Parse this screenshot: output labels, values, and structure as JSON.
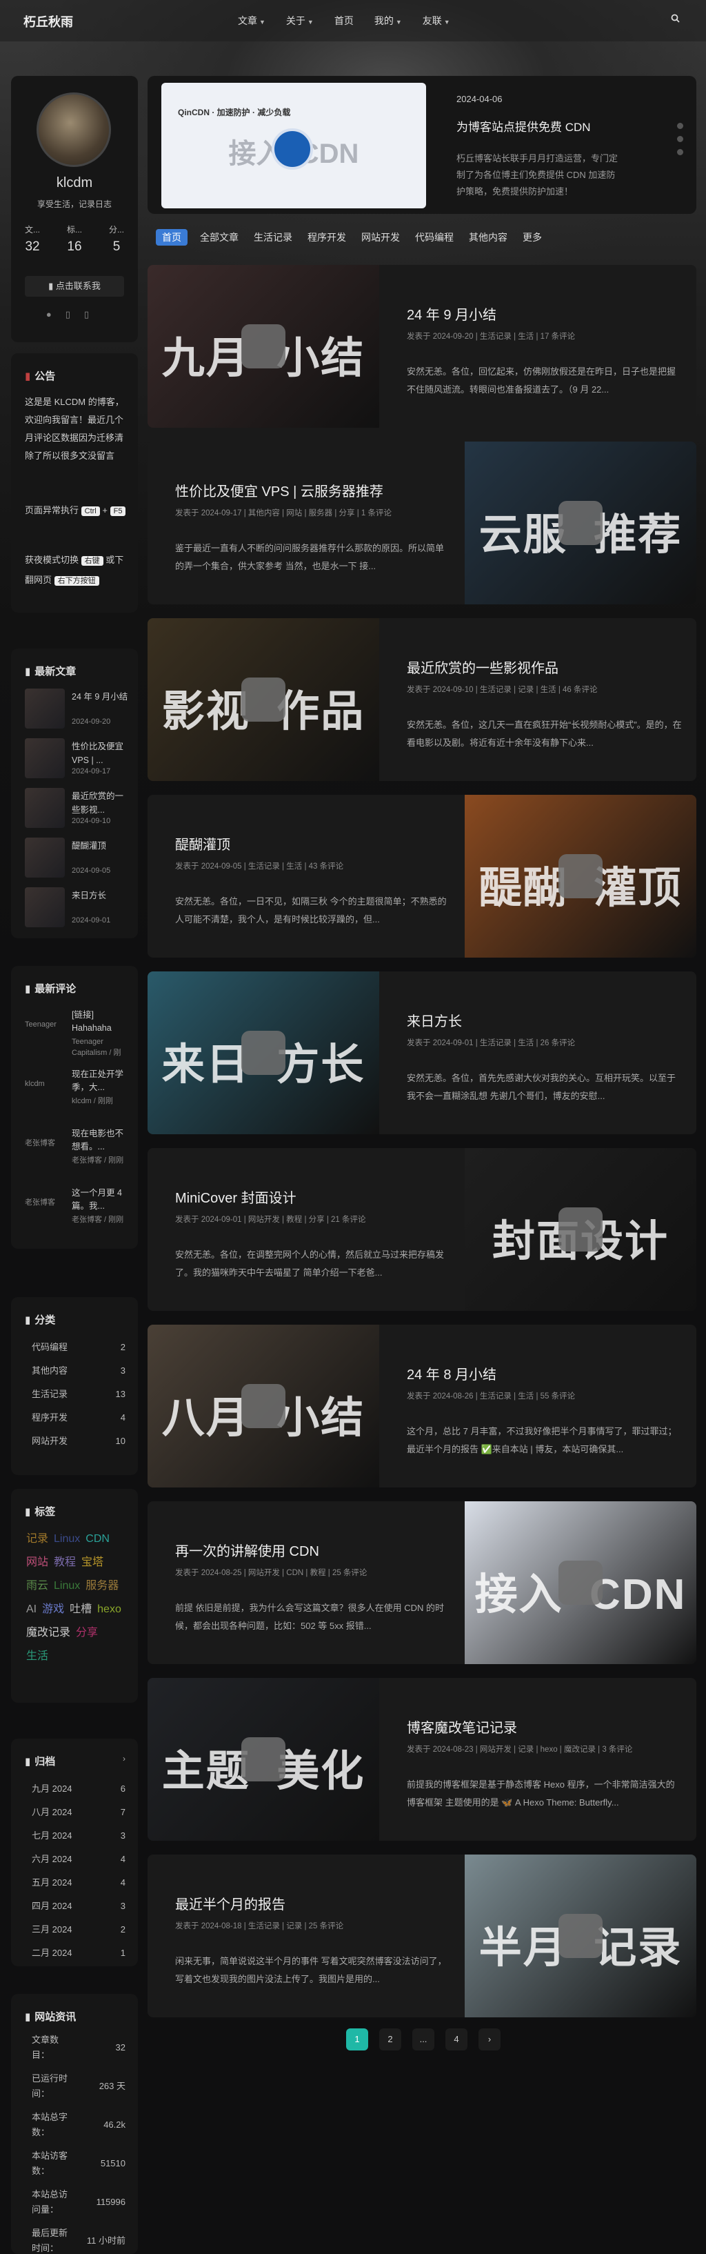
{
  "site": {
    "brand": "朽丘秋雨",
    "search_icon": "search-icon"
  },
  "nav": [
    "文章",
    "关于",
    "首页",
    "我的",
    "友联"
  ],
  "profile": {
    "name": "klcdm",
    "motto": "享受生活，记录日志",
    "stats": [
      {
        "label": "文...",
        "value": "32"
      },
      {
        "label": "标...",
        "value": "16"
      },
      {
        "label": "分...",
        "value": "5"
      }
    ],
    "contact": "点击联系我"
  },
  "notice": {
    "title": "公告",
    "text": "这是是 KLCDM 的博客，欢迎向我留言！最近几个月评论区数据因为迁移清除了所以很多文没留言",
    "line2a": "页面异常执行",
    "key1": "Ctrl",
    "line2b": "+",
    "key2": "F5",
    "line3a": "获夜模式切换",
    "key3": "右键",
    "line3b": "或下翻网页",
    "key4": "右下方按钮"
  },
  "recent_posts": {
    "title": "最新文章",
    "items": [
      {
        "t": "24 年 9 月小结",
        "d": "2024-09-20"
      },
      {
        "t": "性价比及便宜 VPS | ...",
        "d": "2024-09-17"
      },
      {
        "t": "最近欣赏的一些影视...",
        "d": "2024-09-10"
      },
      {
        "t": "醍醐灌顶",
        "d": "2024-09-05"
      },
      {
        "t": "来日方长",
        "d": "2024-09-01"
      }
    ]
  },
  "recent_comments": {
    "title": "最新评论",
    "items": [
      {
        "a": "Teenager",
        "t": "[链接] Hahahaha Sehr...",
        "m": "Teenager Capitalism / 刚刚"
      },
      {
        "a": "klcdm",
        "t": "现在正处开学季，大...",
        "m": "klcdm / 刚刚"
      },
      {
        "a": "老张博客",
        "t": "现在电影也不想看。...",
        "m": "老张博客 / 刚刚"
      },
      {
        "a": "老张博客",
        "t": "这一个月更 4 篇。我...",
        "m": "老张博客 / 刚刚"
      }
    ]
  },
  "categories": {
    "title": "分类",
    "items": [
      {
        "n": "代码编程",
        "c": "2"
      },
      {
        "n": "其他内容",
        "c": "3"
      },
      {
        "n": "生活记录",
        "c": "13"
      },
      {
        "n": "程序开发",
        "c": "4"
      },
      {
        "n": "网站开发",
        "c": "10"
      }
    ]
  },
  "tags": {
    "title": "标签",
    "items": [
      {
        "n": "记录",
        "c": "#a0782a"
      },
      {
        "n": "Linux",
        "c": "#3a4a8a"
      },
      {
        "n": "CDN",
        "c": "#2aa198"
      },
      {
        "n": "网站",
        "c": "#c0507a"
      },
      {
        "n": "教程",
        "c": "#7a6aaa"
      },
      {
        "n": "宝塔",
        "c": "#b8962a"
      },
      {
        "n": "雨云",
        "c": "#5a8a4a"
      },
      {
        "n": "Linux",
        "c": "#3a7a3a"
      },
      {
        "n": "服务器",
        "c": "#9a7a3a"
      },
      {
        "n": "AI",
        "c": "#999999"
      },
      {
        "n": "游戏",
        "c": "#6a7aca"
      },
      {
        "n": "吐槽",
        "c": "#bbbbbb"
      },
      {
        "n": "hexo",
        "c": "#8aa62a"
      },
      {
        "n": "魔改记录",
        "c": "#cccccc"
      },
      {
        "n": "分享",
        "c": "#b0306a"
      },
      {
        "n": "生活",
        "c": "#2a9a7a"
      }
    ]
  },
  "archive": {
    "title": "归档",
    "items": [
      {
        "n": "九月 2024",
        "c": "6"
      },
      {
        "n": "八月 2024",
        "c": "7"
      },
      {
        "n": "七月 2024",
        "c": "3"
      },
      {
        "n": "六月 2024",
        "c": "4"
      },
      {
        "n": "五月 2024",
        "c": "4"
      },
      {
        "n": "四月 2024",
        "c": "3"
      },
      {
        "n": "三月 2024",
        "c": "2"
      },
      {
        "n": "二月 2024",
        "c": "1"
      }
    ]
  },
  "siteinfo": {
    "title": "网站资讯",
    "items": [
      {
        "n": "文章数目：",
        "v": "32"
      },
      {
        "n": "已运行时间：",
        "v": "263 天"
      },
      {
        "n": "本站总字数：",
        "v": "46.2k"
      },
      {
        "n": "本站访客数：",
        "v": "51510"
      },
      {
        "n": "本站总访问量：",
        "v": "115996"
      },
      {
        "n": "最后更新时间：",
        "v": "11 小时前"
      }
    ]
  },
  "featured": {
    "date": "2024-04-06",
    "title": "为博客站点提供免费 CDN",
    "desc": "朽丘博客站长联手月月打造运营，专门定制了为各位博主们免费提供 CDN 加速防护策略，免费提供防护加速！",
    "img_text": "接入  CDN",
    "img_head": "QinCDN · 加速防护 · 减少负载"
  },
  "tabs": [
    "首页",
    "全部文章",
    "生活记录",
    "程序开发",
    "网站开发",
    "代码编程",
    "其他内容",
    "更多"
  ],
  "posts": [
    {
      "title": "24 年 9 月小结",
      "meta": "发表于 2024-09-20 | 生活记录 | 生活 | 17 条评论",
      "desc": "安然无恙。各位，回忆起来，仿佛刚放假还是在昨日，日子也是把握不住随风逝流。转眼间也准备报道去了。（9 月 22...",
      "img": "九月  小结",
      "color": "#3a2a2a",
      "side": "left"
    },
    {
      "title": "性价比及便宜 VPS | 云服务器推荐",
      "meta": "发表于 2024-09-17 | 其他内容 | 网站 | 服务器 | 分享 | 1 条评论",
      "desc": "鉴于最近一直有人不断的问问服务器推荐什么那款的原因。所以简单的弄一个集合，供大家参考 当然，也是水一下 接...",
      "img": "云服  推荐",
      "color": "#243544",
      "side": "right"
    },
    {
      "title": "最近欣赏的一些影视作品",
      "meta": "发表于 2024-09-10 | 生活记录 | 记录 | 生活 | 46 条评论",
      "desc": "安然无恙。各位，这几天一直在疯狂开始“长视频耐心模式”。是的，在看电影以及剧。将近有近十余年没有静下心来...",
      "img": "影视  作品",
      "color": "#3a3020",
      "side": "left"
    },
    {
      "title": "醍醐灌顶",
      "meta": "发表于 2024-09-05 | 生活记录 | 生活 | 43 条评论",
      "desc": "安然无恙。各位，一日不见，如隔三秋 今个的主题很简单；不熟悉的人可能不清楚，我个人，是有时候比较浮躁的，但...",
      "img": "醍醐  灌顶",
      "color": "#8a4a20",
      "side": "right"
    },
    {
      "title": "来日方长",
      "meta": "发表于 2024-09-01 | 生活记录 | 生活 | 26 条评论",
      "desc": "安然无恙。各位，首先先感谢大伙对我的关心。互相开玩笑。以至于我不会一直糊涂乱想 先谢几个哥们，博友的安慰...",
      "img": "来日  方长",
      "color": "#2a5a6a",
      "side": "left"
    },
    {
      "title": "MiniCover 封面设计",
      "meta": "发表于 2024-09-01 | 网站开发 | 教程 | 分享 | 21 条评论",
      "desc": "安然无恙。各位，在调整完网个人的心情，然后就立马过来把存稿发了。我的猫咪昨天中午去喵星了 简单介绍一下老爸...",
      "img": "封面设计",
      "color": "#1e1e1e",
      "side": "right"
    },
    {
      "title": "24 年 8 月小结",
      "meta": "发表于 2024-08-26 | 生活记录 | 生活 | 55 条评论",
      "desc": "这个月，总比 7 月丰富，不过我好像把半个月事情写了，罪过罪过；最近半个月的报告 ✅来自本站 | 博友，本站可确保其...",
      "img": "八月  小结",
      "color": "#4a4036",
      "side": "left"
    },
    {
      "title": "再一次的讲解使用 CDN",
      "meta": "发表于 2024-08-25 | 网站开发 | CDN | 教程 | 25 条评论",
      "desc": "前提 依旧是前提，我为什么会写这篇文章？很多人在使用 CDN 的时候，都会出现各种问题，比如：502 等 5xx 报错...",
      "img": "接入  CDN",
      "color": "#d8dde6",
      "side": "right"
    },
    {
      "title": "博客魔改笔记记录",
      "meta": "发表于 2024-08-23 | 网站开发 | 记录 | hexo | 魔改记录 | 3 条评论",
      "desc": "前提我的博客框架是基于静态博客 Hexo 程序，一个非常简洁强大的博客框架 主题使用的是 🦋 A Hexo Theme: Butterfly...",
      "img": "主题  美化",
      "color": "#202226",
      "side": "left"
    },
    {
      "title": "最近半个月的报告",
      "meta": "发表于 2024-08-18 | 生活记录 | 记录 | 25 条评论",
      "desc": "闲来无事，简单说说这半个月的事件 写着文呢突然博客没法访问了，写着文也发现我的图片没法上传了。我图片是用的...",
      "img": "半月  记录",
      "color": "#7a8a90",
      "side": "right"
    }
  ],
  "pagination": [
    "1",
    "2",
    "...",
    "4",
    "›"
  ]
}
